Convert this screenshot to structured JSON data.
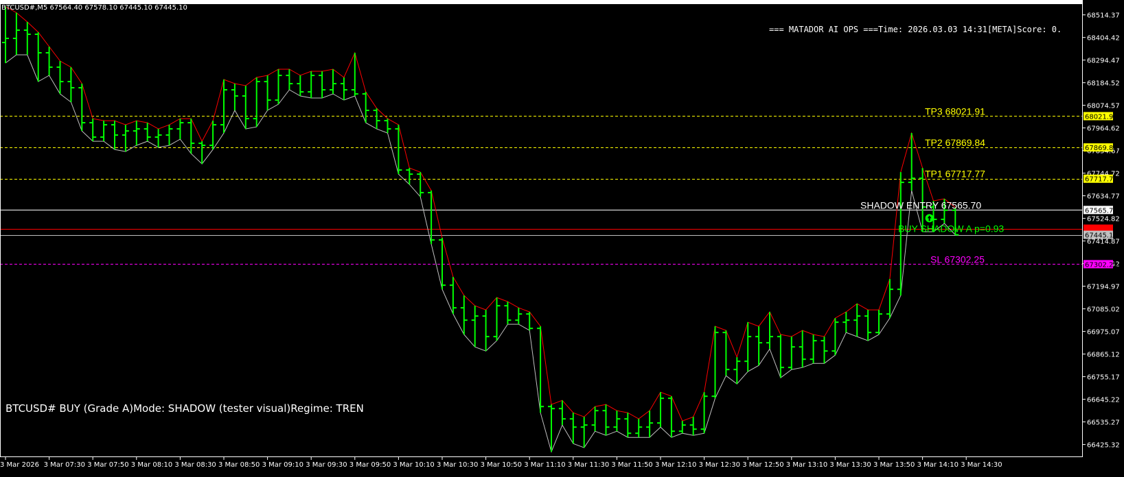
{
  "window": {
    "ohlc_header": "BTCUSD#,M5  67564.40 67578.10 67445.10 67445.10",
    "ops_text": "=== MATADOR AI OPS ===Time: 2026.03.03 14:31[META]Score: 0.",
    "status_text": "BTCUSD# BUY (Grade A)Mode: SHADOW (tester visual)Regime: TREN"
  },
  "colors": {
    "background": "#000000",
    "frame": "#ffffff",
    "bar": "#00ff00",
    "high_line": "#ff0000",
    "low_line": "#c0c0c0",
    "tp": "#ffff00",
    "sl": "#ff00ff",
    "entry": "#ffffff",
    "signal": "#00ff00",
    "bid": "#c0c0c0",
    "ask": "#ff0000",
    "text": "#ffffff"
  },
  "levels": [
    {
      "name": "tp3",
      "label": "TP3 68021.91",
      "price": 68021.91,
      "tag": "68021.91",
      "style": "dashed",
      "color": "#ffff00",
      "tag_fg": "#000000"
    },
    {
      "name": "tp2",
      "label": "TP2 67869.84",
      "price": 67869.84,
      "tag": "67869.84",
      "style": "dashed",
      "color": "#ffff00",
      "tag_fg": "#000000"
    },
    {
      "name": "tp1",
      "label": "TP1 67717.77",
      "price": 67717.77,
      "tag": "67717.77",
      "style": "dashed",
      "color": "#ffff00",
      "tag_fg": "#000000"
    },
    {
      "name": "entry",
      "label": "SHADOW ENTRY 67565.70",
      "price": 67565.7,
      "tag": "67565.70",
      "style": "solid",
      "color": "#ffffff",
      "tag_fg": "#000000"
    },
    {
      "name": "ask",
      "label": "",
      "price": 67475.0,
      "tag": "",
      "style": "solid",
      "color": "#ff0000",
      "tag_fg": "#ffffff"
    },
    {
      "name": "bid",
      "label": "",
      "price": 67445.1,
      "tag": "67445.10",
      "style": "solid",
      "color": "#c0c0c0",
      "tag_fg": "#000000"
    },
    {
      "name": "sl",
      "label": "SL 67302.25",
      "price": 67302.25,
      "tag": "67302.25",
      "style": "dashed",
      "color": "#ff00ff",
      "tag_fg": "#000000"
    }
  ],
  "signal": {
    "label": "BUY SHADOW A p=0.93",
    "marker": "buy-arrow-icon",
    "at_time": "3 Mar 14:25",
    "price": 67565.7
  },
  "chart_data": {
    "type": "ohlc",
    "symbol": "BTCUSD#",
    "timeframe": "M5",
    "ylim": [
      66364.0,
      68570.0
    ],
    "y_ticks": [
      68514.37,
      68404.42,
      68294.47,
      68184.52,
      68074.57,
      67964.62,
      67854.67,
      67744.72,
      67634.77,
      67524.82,
      67414.87,
      67304.92,
      67194.97,
      67085.02,
      66975.07,
      66865.12,
      66755.17,
      66645.22,
      66535.27,
      66425.32
    ],
    "x_ticks": [
      {
        "label": "3 Mar 2026",
        "index": 0
      },
      {
        "label": "3 Mar 07:30",
        "index": 4
      },
      {
        "label": "3 Mar 07:50",
        "index": 8
      },
      {
        "label": "3 Mar 08:10",
        "index": 12
      },
      {
        "label": "3 Mar 08:30",
        "index": 16
      },
      {
        "label": "3 Mar 08:50",
        "index": 20
      },
      {
        "label": "3 Mar 09:10",
        "index": 24
      },
      {
        "label": "3 Mar 09:30",
        "index": 28
      },
      {
        "label": "3 Mar 09:50",
        "index": 32
      },
      {
        "label": "3 Mar 10:10",
        "index": 36
      },
      {
        "label": "3 Mar 10:30",
        "index": 40
      },
      {
        "label": "3 Mar 10:50",
        "index": 44
      },
      {
        "label": "3 Mar 11:10",
        "index": 48
      },
      {
        "label": "3 Mar 11:30",
        "index": 52
      },
      {
        "label": "3 Mar 11:50",
        "index": 56
      },
      {
        "label": "3 Mar 12:10",
        "index": 60
      },
      {
        "label": "3 Mar 12:30",
        "index": 64
      },
      {
        "label": "3 Mar 12:50",
        "index": 68
      },
      {
        "label": "3 Mar 13:10",
        "index": 72
      },
      {
        "label": "3 Mar 13:30",
        "index": 76
      },
      {
        "label": "3 Mar 13:50",
        "index": 80
      },
      {
        "label": "3 Mar 14:10",
        "index": 84
      },
      {
        "label": "3 Mar 14:30",
        "index": 88
      }
    ],
    "bars": [
      [
        68380,
        68555,
        68280,
        68400
      ],
      [
        68400,
        68525,
        68320,
        68440
      ],
      [
        68440,
        68480,
        68320,
        68420
      ],
      [
        68420,
        68430,
        68190,
        68330
      ],
      [
        68330,
        68360,
        68220,
        68260
      ],
      [
        68260,
        68290,
        68130,
        68190
      ],
      [
        68190,
        68260,
        68090,
        68160
      ],
      [
        68160,
        68180,
        67950,
        67990
      ],
      [
        67990,
        68010,
        67900,
        67920
      ],
      [
        67920,
        68000,
        67900,
        67980
      ],
      [
        67980,
        68000,
        67860,
        67930
      ],
      [
        67930,
        67980,
        67850,
        67950
      ],
      [
        67950,
        68000,
        67880,
        67960
      ],
      [
        67960,
        67990,
        67900,
        67920
      ],
      [
        67920,
        67960,
        67870,
        67930
      ],
      [
        67930,
        67980,
        67880,
        67960
      ],
      [
        67960,
        68010,
        67910,
        67990
      ],
      [
        67990,
        68010,
        67840,
        67890
      ],
      [
        67890,
        67900,
        67790,
        67880
      ],
      [
        67880,
        68000,
        67860,
        67980
      ],
      [
        67980,
        68200,
        67940,
        68150
      ],
      [
        68150,
        68180,
        68050,
        68120
      ],
      [
        68120,
        68170,
        67960,
        68010
      ],
      [
        68010,
        68210,
        67970,
        68190
      ],
      [
        68190,
        68220,
        68050,
        68100
      ],
      [
        68100,
        68250,
        68080,
        68220
      ],
      [
        68220,
        68250,
        68150,
        68180
      ],
      [
        68180,
        68220,
        68120,
        68140
      ],
      [
        68140,
        68240,
        68110,
        68220
      ],
      [
        68220,
        68240,
        68110,
        68150
      ],
      [
        68150,
        68250,
        68130,
        68180
      ],
      [
        68180,
        68210,
        68100,
        68150
      ],
      [
        68150,
        68330,
        68120,
        68130
      ],
      [
        68130,
        68140,
        67990,
        68050
      ],
      [
        68050,
        68060,
        67960,
        68000
      ],
      [
        68000,
        68010,
        67940,
        67960
      ],
      [
        67960,
        67980,
        67740,
        67760
      ],
      [
        67760,
        67770,
        67690,
        67740
      ],
      [
        67740,
        67750,
        67630,
        67650
      ],
      [
        67650,
        67660,
        67400,
        67420
      ],
      [
        67420,
        67430,
        67180,
        67200
      ],
      [
        67200,
        67240,
        67060,
        67090
      ],
      [
        67090,
        67150,
        66960,
        67030
      ],
      [
        67030,
        67100,
        66900,
        67050
      ],
      [
        67050,
        67080,
        66880,
        66950
      ],
      [
        66950,
        67140,
        66930,
        67100
      ],
      [
        67100,
        67120,
        67010,
        67030
      ],
      [
        67030,
        67090,
        67010,
        67060
      ],
      [
        67060,
        67070,
        66980,
        66990
      ],
      [
        66990,
        67000,
        66580,
        66610
      ],
      [
        66610,
        66620,
        66390,
        66600
      ],
      [
        66600,
        66640,
        66520,
        66550
      ],
      [
        66550,
        66580,
        66430,
        66510
      ],
      [
        66510,
        66560,
        66410,
        66520
      ],
      [
        66520,
        66610,
        66490,
        66590
      ],
      [
        66590,
        66620,
        66470,
        66510
      ],
      [
        66510,
        66590,
        66490,
        66550
      ],
      [
        66550,
        66580,
        66460,
        66480
      ],
      [
        66480,
        66550,
        66460,
        66510
      ],
      [
        66510,
        66590,
        66460,
        66530
      ],
      [
        66530,
        66680,
        66510,
        66650
      ],
      [
        66650,
        66660,
        66460,
        66490
      ],
      [
        66490,
        66540,
        66480,
        66520
      ],
      [
        66520,
        66560,
        66470,
        66500
      ],
      [
        66500,
        66680,
        66480,
        66660
      ],
      [
        66660,
        67000,
        66650,
        66970
      ],
      [
        66970,
        66980,
        66760,
        66790
      ],
      [
        66790,
        66850,
        66720,
        66830
      ],
      [
        66830,
        67020,
        66780,
        66950
      ],
      [
        66950,
        67000,
        66810,
        66920
      ],
      [
        66920,
        67070,
        66890,
        66950
      ],
      [
        66950,
        66960,
        66750,
        66800
      ],
      [
        66800,
        66950,
        66790,
        66900
      ],
      [
        66900,
        66980,
        66800,
        66840
      ],
      [
        66840,
        66960,
        66820,
        66930
      ],
      [
        66930,
        66950,
        66820,
        66880
      ],
      [
        66880,
        67040,
        66860,
        67020
      ],
      [
        67020,
        67070,
        66970,
        67030
      ],
      [
        67030,
        67110,
        66950,
        67050
      ],
      [
        67050,
        67080,
        66930,
        66970
      ],
      [
        66970,
        67080,
        66960,
        67060
      ],
      [
        67060,
        67230,
        67040,
        67180
      ],
      [
        67180,
        67750,
        67150,
        67700
      ],
      [
        67700,
        67940,
        67660,
        67720
      ],
      [
        67720,
        67770,
        67460,
        67580
      ],
      [
        67580,
        67610,
        67460,
        67520
      ],
      [
        67520,
        67620,
        67500,
        67564.4
      ],
      [
        67564.4,
        67578.1,
        67445.1,
        67445.1
      ]
    ]
  }
}
